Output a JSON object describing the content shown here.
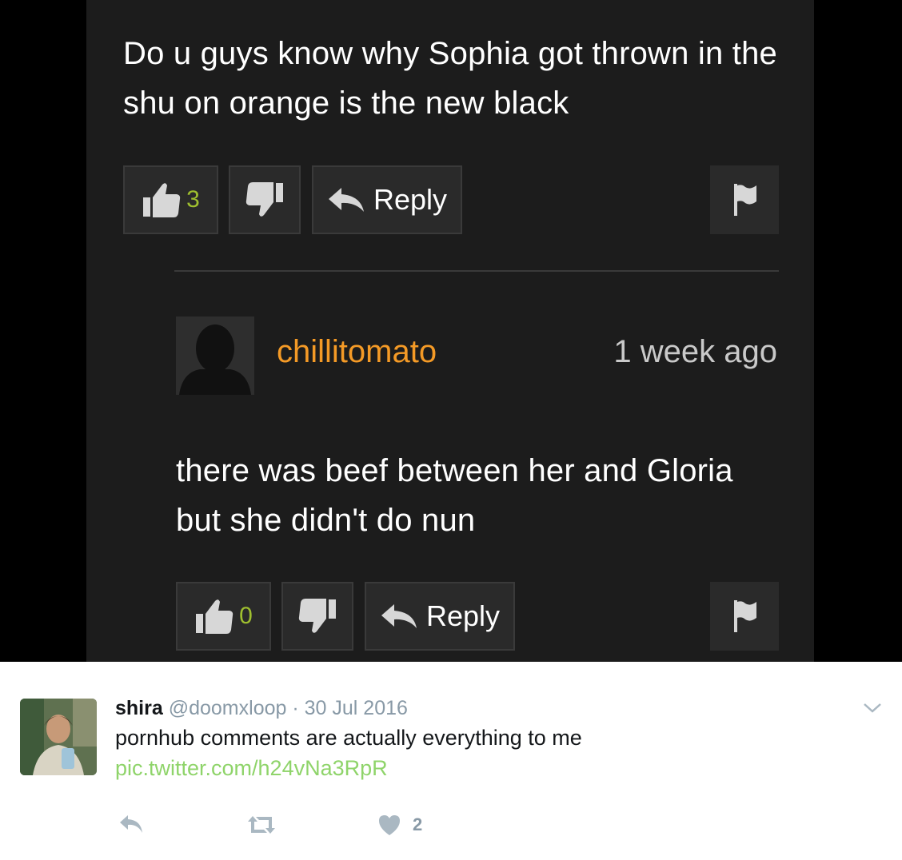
{
  "comment": {
    "text": "Do u guys know why Sophia got thrown in the shu on orange is the new black",
    "upvote_count": "3",
    "reply_label": "Reply"
  },
  "reply_comment": {
    "username": "chillitomato",
    "time_ago": "1 week ago",
    "text": "there was beef between her and Gloria but she didn't do nun",
    "upvote_count": "0",
    "reply_label": "Reply"
  },
  "tweet": {
    "name": "shira",
    "handle": "@doomxloop",
    "separator": "·",
    "date": "30 Jul 2016",
    "text": "pornhub comments are actually everything to me",
    "link": "pic.twitter.com/h24vNa3RpR",
    "like_count": "2"
  },
  "icons": [
    "thumbs-up-icon",
    "thumbs-down-icon",
    "reply-arrow-icon",
    "flag-icon",
    "chevron-down-icon",
    "retweet-icon",
    "heart-icon"
  ],
  "colors": {
    "username": "#f49a26",
    "upvote_count": "#9fbf2f",
    "tweet_link": "#8fd46a",
    "panel_bg": "#1c1c1c"
  }
}
